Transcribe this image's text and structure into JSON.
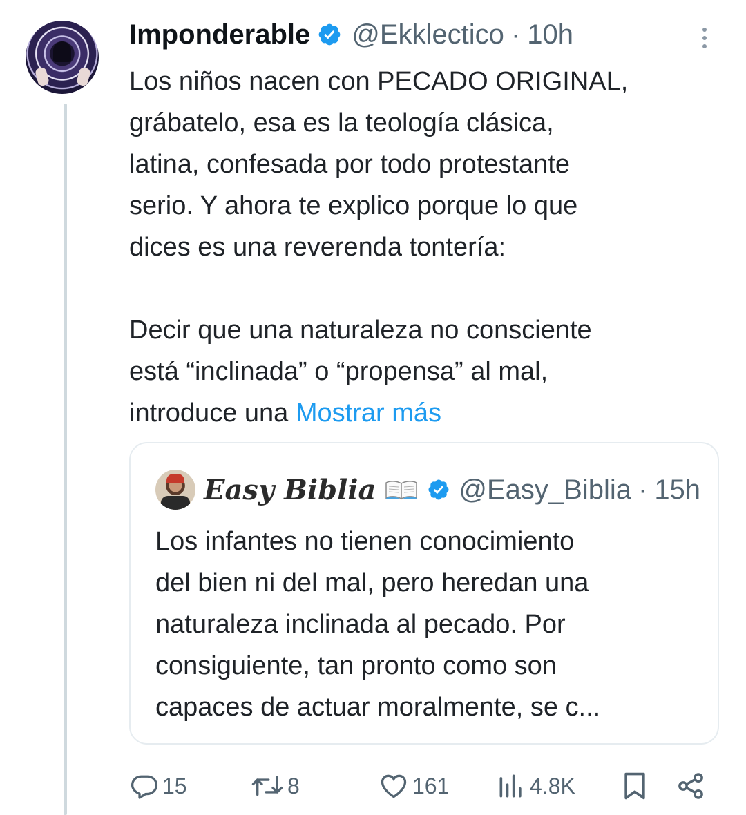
{
  "tweet": {
    "author_name": "Imponderable",
    "handle": "@Ekklectico",
    "separator": "·",
    "time": "10h",
    "avatar_icon": "hooded-figure-avatar",
    "verified_icon": "verified-badge-icon",
    "text_lines": [
      "Los niños nacen con PECADO ORIGINAL,",
      "grábatelo, esa es la teología clásica,",
      "latina, confesada por todo protestante",
      "serio. Y ahora te explico porque lo que",
      "dices es una reverenda tontería:"
    ],
    "text_lines_2": [
      "Decir que una naturaleza no consciente",
      "está “inclinada” o “propensa” al mal,"
    ],
    "last_line_prefix": "introduce una ",
    "show_more": "Mostrar más"
  },
  "quoted": {
    "author_name": "Easy Biblia",
    "emoji_icon": "open-book-emoji",
    "handle": "@Easy_Biblia",
    "separator": "·",
    "time": "15h",
    "text_lines": [
      "Los infantes no tienen conocimiento",
      "del bien ni del mal, pero heredan una",
      "naturaleza inclinada al pecado. Por",
      "consiguiente, tan pronto como son",
      "capaces de actuar moralmente, se c..."
    ]
  },
  "actions": {
    "replies": "15",
    "reposts": "8",
    "likes": "161",
    "views": "4.8K"
  },
  "colors": {
    "link": "#1d9bf0",
    "verified": "#1d9bf0",
    "muted": "#536471",
    "thread_line": "#cfd9de"
  }
}
